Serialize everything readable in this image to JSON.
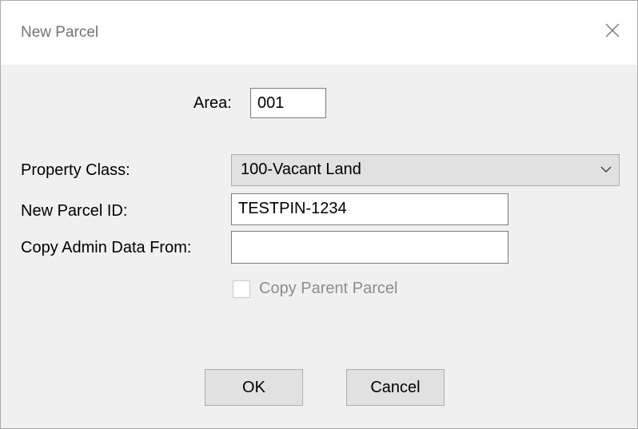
{
  "window": {
    "title": "New Parcel"
  },
  "form": {
    "area_label": "Area:",
    "area_value": "001",
    "property_class_label": "Property Class:",
    "property_class_value": "100-Vacant Land",
    "new_parcel_id_label": "New Parcel ID:",
    "new_parcel_id_value": "TESTPIN-1234",
    "copy_admin_label": "Copy Admin Data From:",
    "copy_admin_value": "",
    "copy_parent_label": "Copy Parent Parcel",
    "copy_parent_checked": false,
    "copy_parent_enabled": false
  },
  "buttons": {
    "ok_label": "OK",
    "cancel_label": "Cancel"
  },
  "icons": {
    "close": "close-icon",
    "dropdown": "chevron-down-icon"
  }
}
